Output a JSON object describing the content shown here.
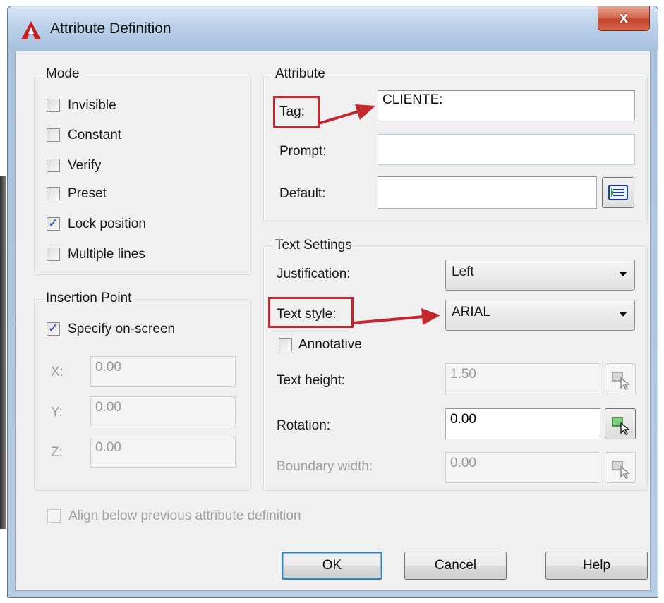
{
  "window": {
    "title": "Attribute Definition",
    "close_glyph": "x"
  },
  "mode": {
    "label": "Mode",
    "items": [
      {
        "label": "Invisible",
        "checked": false
      },
      {
        "label": "Constant",
        "checked": false
      },
      {
        "label": "Verify",
        "checked": false
      },
      {
        "label": "Preset",
        "checked": false
      },
      {
        "label": "Lock position",
        "checked": true
      },
      {
        "label": "Multiple lines",
        "checked": false
      }
    ]
  },
  "insertion": {
    "label": "Insertion Point",
    "specify_label": "Specify on-screen",
    "specify_checked": true,
    "x_label": "X:",
    "x_value": "0.00",
    "y_label": "Y:",
    "y_value": "0.00",
    "z_label": "Z:",
    "z_value": "0.00"
  },
  "attribute": {
    "label": "Attribute",
    "tag_label": "Tag:",
    "tag_value": "CLIENTE:",
    "prompt_label": "Prompt:",
    "prompt_value": "",
    "default_label": "Default:",
    "default_value": ""
  },
  "text_settings": {
    "label": "Text Settings",
    "justification_label": "Justification:",
    "justification_value": "Left",
    "style_label": "Text style:",
    "style_value": "ARIAL",
    "annotative_label": "Annotative",
    "annotative_checked": false,
    "height_label": "Text height:",
    "height_value": "1.50",
    "rotation_label": "Rotation:",
    "rotation_value": "0.00",
    "boundary_label": "Boundary width:",
    "boundary_value": "0.00"
  },
  "align_label": "Align below previous attribute definition",
  "buttons": {
    "ok": "OK",
    "cancel": "Cancel",
    "help": "Help"
  },
  "colors": {
    "annotation_red": "#c4282f",
    "frame_blue": "#a9c2de",
    "close_red": "#c2432a"
  },
  "icons": [
    "autocad-icon",
    "insert-field-icon",
    "pick-point-icon"
  ]
}
